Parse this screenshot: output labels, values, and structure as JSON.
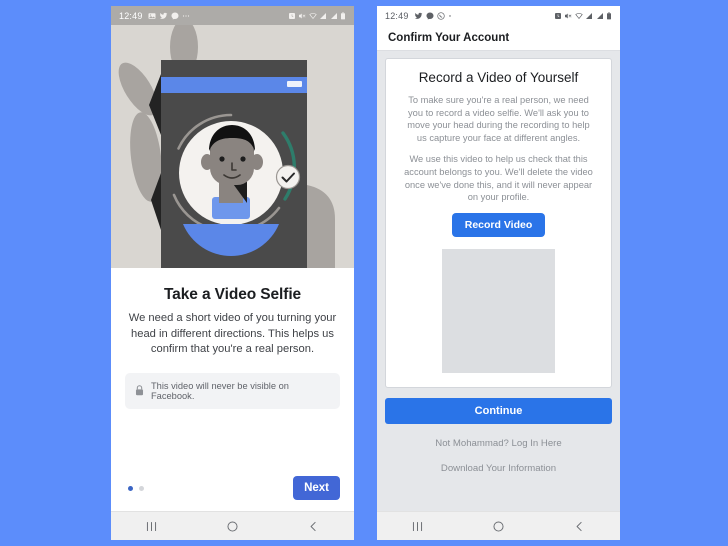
{
  "background_color": "#5c8dfb",
  "accent_color": "#2a74e8",
  "left_phone": {
    "status_bar": {
      "time": "12:49",
      "left_icons": [
        "photo-icon",
        "twitter-icon",
        "messenger-icon",
        "more-icon"
      ],
      "right_icons": [
        "alarm-icon",
        "mute-icon",
        "wifi-icon",
        "signal-icon",
        "signal-icon",
        "battery-icon"
      ]
    },
    "illustration": {
      "name": "video-selfie-illustration",
      "description": "hand holding a phone showing a face inside a circular scan frame with a teal progress arc and a checkmark badge",
      "colors": {
        "backdrop": "#d9d6d1",
        "hand": "#a09c99",
        "phone_body": "#4a4a4a",
        "app_bar": "#5b87e8",
        "circle": "#f4f2ef",
        "progress_arc": "#2e7d6b",
        "skin": "#8a8480",
        "hair": "#111111",
        "shirt": "#5b87e8"
      }
    },
    "title": "Take a Video Selfie",
    "subtitle": "We need a short video of you turning your head in different directions. This helps us confirm that you're a real person.",
    "privacy_notice": "This video will never be visible on Facebook.",
    "privacy_icon": "lock-icon",
    "pagination": {
      "total": 2,
      "active": 1
    },
    "next_label": "Next",
    "nav_bar": [
      "recents-icon",
      "home-icon",
      "back-icon"
    ]
  },
  "right_phone": {
    "status_bar": {
      "time": "12:49",
      "left_icons": [
        "twitter-icon",
        "messenger-icon",
        "whatsapp-icon",
        "more-icon"
      ],
      "right_icons": [
        "alarm-icon",
        "mute-icon",
        "wifi-icon",
        "signal-icon",
        "signal-icon",
        "battery-icon"
      ]
    },
    "header_title": "Confirm Your Account",
    "card": {
      "title": "Record a Video of Yourself",
      "paragraph_1": "To make sure you're a real person, we need you to record a video selfie. We'll ask you to move your head during the recording to help us capture your face at different angles.",
      "paragraph_2": "We use this video to help us check that this account belongs to you. We'll delete the video once we've done this, and it will never appear on your profile.",
      "record_label": "Record Video",
      "video_placeholder": "video-preview-placeholder"
    },
    "continue_label": "Continue",
    "links": [
      "Not Mohammad? Log In Here",
      "Download Your Information"
    ],
    "nav_bar": [
      "recents-icon",
      "home-icon",
      "back-icon"
    ]
  }
}
